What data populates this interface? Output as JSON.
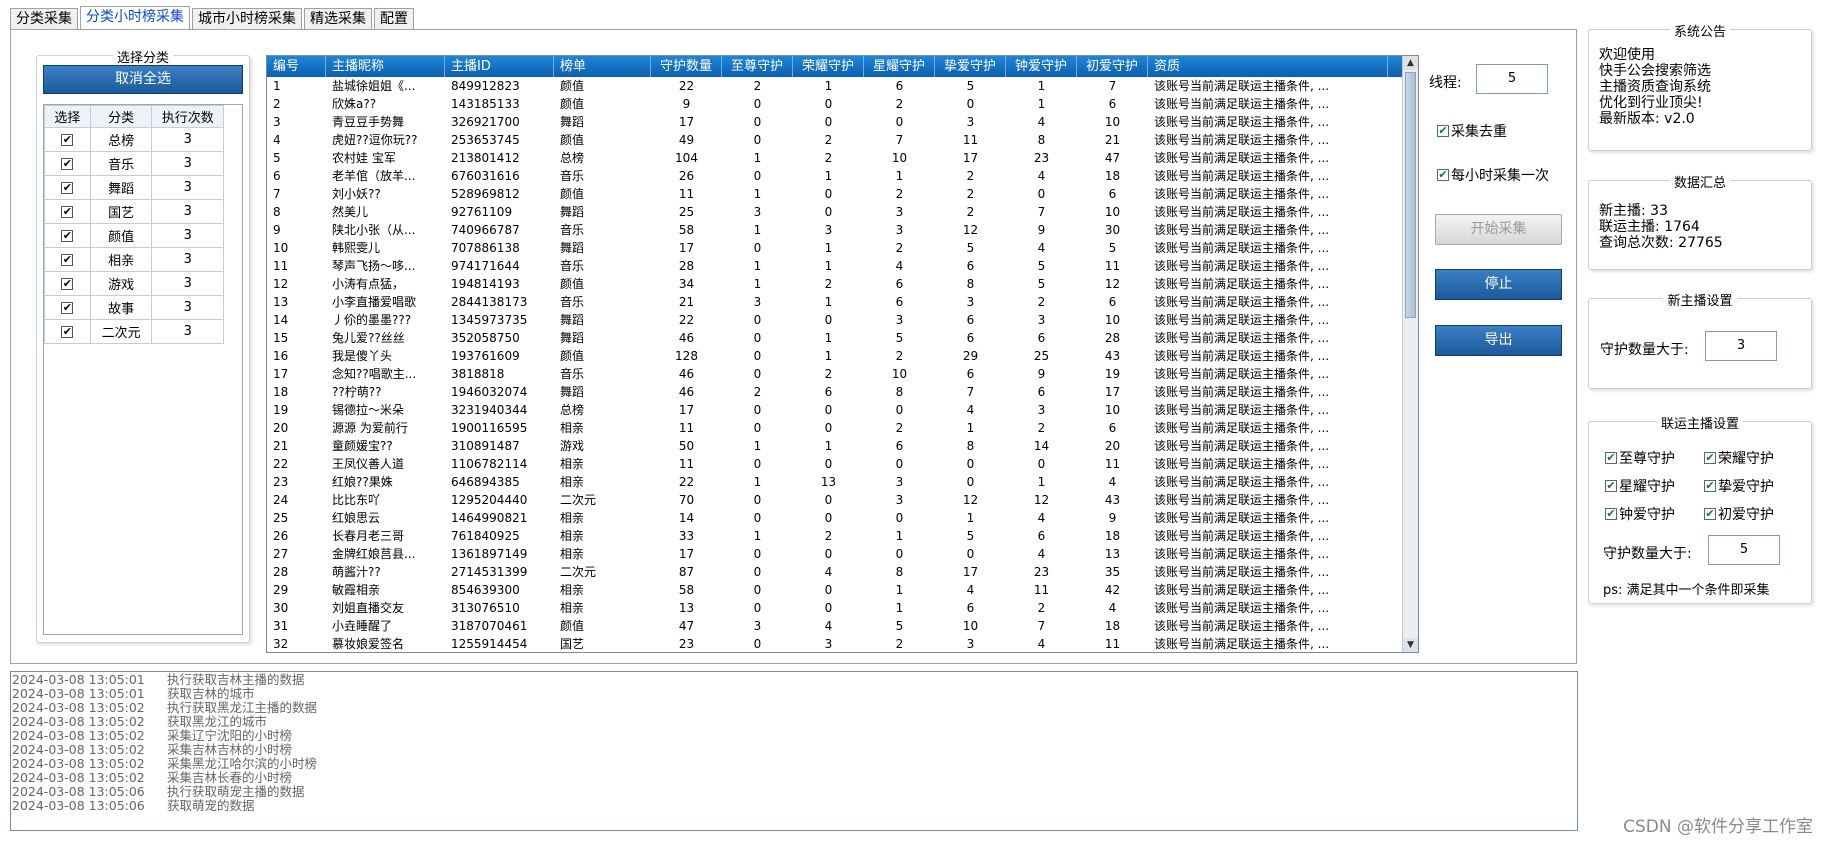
{
  "tabs": [
    "分类采集",
    "分类小时榜采集",
    "城市小时榜采集",
    "精选采集",
    "配置"
  ],
  "category_group": {
    "title": "选择分类",
    "deselect_button": "取消全选",
    "headers": [
      "选择",
      "分类",
      "执行次数"
    ],
    "rows": [
      {
        "name": "总榜",
        "count": "3"
      },
      {
        "name": "音乐",
        "count": "3"
      },
      {
        "name": "舞蹈",
        "count": "3"
      },
      {
        "name": "国艺",
        "count": "3"
      },
      {
        "name": "颜值",
        "count": "3"
      },
      {
        "name": "相亲",
        "count": "3"
      },
      {
        "name": "游戏",
        "count": "3"
      },
      {
        "name": "故事",
        "count": "3"
      },
      {
        "name": "二次元",
        "count": "3"
      }
    ]
  },
  "grid": {
    "headers": [
      "编号",
      "主播昵称",
      "主播ID",
      "榜单",
      "守护数量",
      "至尊守护",
      "荣耀守护",
      "星耀守护",
      "挚爱守护",
      "钟爱守护",
      "初爱守护",
      "资质"
    ],
    "qualification": "该账号当前满足联运主播条件, ...",
    "rows": [
      [
        "1",
        "盐城徐姐姐《...",
        "849912823",
        "颜值",
        "22",
        "2",
        "1",
        "6",
        "5",
        "1",
        "7"
      ],
      [
        "2",
        "欣姝a??",
        "143185133",
        "颜值",
        "9",
        "0",
        "0",
        "2",
        "0",
        "1",
        "6"
      ],
      [
        "3",
        "青豆豆手势舞",
        "326921700",
        "舞蹈",
        "17",
        "0",
        "0",
        "0",
        "3",
        "4",
        "10"
      ],
      [
        "4",
        "虎妞??逗你玩??",
        "253653745",
        "颜值",
        "49",
        "0",
        "2",
        "7",
        "11",
        "8",
        "21"
      ],
      [
        "5",
        "农村娃 宝军",
        "213801412",
        "总榜",
        "104",
        "1",
        "2",
        "10",
        "17",
        "23",
        "47"
      ],
      [
        "6",
        "老羊倌（放羊...",
        "676031616",
        "音乐",
        "26",
        "0",
        "1",
        "1",
        "2",
        "4",
        "18"
      ],
      [
        "7",
        "刘小妖??",
        "528969812",
        "颜值",
        "11",
        "1",
        "0",
        "2",
        "2",
        "0",
        "6"
      ],
      [
        "8",
        "然美儿",
        "92761109",
        "舞蹈",
        "25",
        "3",
        "0",
        "3",
        "2",
        "7",
        "10"
      ],
      [
        "9",
        "陕北小张（从...",
        "740966787",
        "音乐",
        "58",
        "1",
        "3",
        "3",
        "12",
        "9",
        "30"
      ],
      [
        "10",
        "韩熙雯儿",
        "707886138",
        "舞蹈",
        "17",
        "0",
        "1",
        "2",
        "5",
        "4",
        "5"
      ],
      [
        "11",
        "琴声飞扬～哆...",
        "974171644",
        "音乐",
        "28",
        "1",
        "1",
        "4",
        "6",
        "5",
        "11"
      ],
      [
        "12",
        "小涛有点猛，",
        "194814193",
        "颜值",
        "34",
        "1",
        "2",
        "6",
        "8",
        "5",
        "12"
      ],
      [
        "13",
        "小李直播爱唱歌",
        "2844138173",
        "音乐",
        "21",
        "3",
        "1",
        "6",
        "3",
        "2",
        "6"
      ],
      [
        "14",
        "丿伱的墨墨???",
        "1345973735",
        "舞蹈",
        "22",
        "0",
        "0",
        "3",
        "6",
        "3",
        "10"
      ],
      [
        "15",
        "兔儿爱??丝丝",
        "352058750",
        "舞蹈",
        "46",
        "0",
        "1",
        "5",
        "6",
        "6",
        "28"
      ],
      [
        "16",
        "我是傻丫头",
        "193761609",
        "颜值",
        "128",
        "0",
        "1",
        "2",
        "29",
        "25",
        "43"
      ],
      [
        "17",
        "念知??唱歌主...",
        "3818818",
        "音乐",
        "46",
        "0",
        "2",
        "10",
        "6",
        "9",
        "19"
      ],
      [
        "18",
        "??柠萌??",
        "1946032074",
        "舞蹈",
        "46",
        "2",
        "6",
        "8",
        "7",
        "6",
        "17"
      ],
      [
        "19",
        "锡德拉～米朵",
        "3231940344",
        "总榜",
        "17",
        "0",
        "0",
        "0",
        "4",
        "3",
        "10"
      ],
      [
        "20",
        "源源 为爱前行",
        "1900116595",
        "相亲",
        "11",
        "0",
        "0",
        "2",
        "1",
        "2",
        "6"
      ],
      [
        "21",
        "童颜媛宝??",
        "310891487",
        "游戏",
        "50",
        "1",
        "1",
        "6",
        "8",
        "14",
        "20"
      ],
      [
        "22",
        "王凤仪善人道",
        "1106782114",
        "相亲",
        "11",
        "0",
        "0",
        "0",
        "0",
        "0",
        "11"
      ],
      [
        "23",
        "红娘??果姝",
        "646894385",
        "相亲",
        "22",
        "1",
        "13",
        "3",
        "0",
        "1",
        "4"
      ],
      [
        "24",
        "比比东吖",
        "1295204440",
        "二次元",
        "70",
        "0",
        "0",
        "3",
        "12",
        "12",
        "43"
      ],
      [
        "25",
        "红娘思云",
        "1464990821",
        "相亲",
        "14",
        "0",
        "0",
        "0",
        "1",
        "4",
        "9"
      ],
      [
        "26",
        "长春月老三哥",
        "761840925",
        "相亲",
        "33",
        "1",
        "2",
        "1",
        "5",
        "6",
        "18"
      ],
      [
        "27",
        "金牌红娘莒县...",
        "1361897149",
        "相亲",
        "17",
        "0",
        "0",
        "0",
        "0",
        "4",
        "13"
      ],
      [
        "28",
        "萌酱汁??",
        "2714531399",
        "二次元",
        "87",
        "0",
        "4",
        "8",
        "17",
        "23",
        "35"
      ],
      [
        "29",
        "敏霞相亲",
        "854639300",
        "相亲",
        "58",
        "0",
        "0",
        "1",
        "4",
        "11",
        "42"
      ],
      [
        "30",
        "刘姐直播交友",
        "313076510",
        "相亲",
        "13",
        "0",
        "0",
        "1",
        "6",
        "2",
        "4"
      ],
      [
        "31",
        "小垚睡醒了",
        "3187070461",
        "颜值",
        "47",
        "3",
        "4",
        "5",
        "10",
        "7",
        "18"
      ],
      [
        "32",
        "慕妆娘爱签名",
        "1255914454",
        "国艺",
        "23",
        "0",
        "3",
        "2",
        "3",
        "4",
        "11"
      ]
    ]
  },
  "controls": {
    "threads_label": "线程:",
    "threads_value": "5",
    "dedupe_label": "采集去重",
    "hourly_label": "每小时采集一次",
    "start_button": "开始采集",
    "stop_button": "停止",
    "export_button": "导出"
  },
  "system_notice": {
    "title": "系统公告",
    "lines": [
      "欢迎使用",
      "快手公会搜索筛选",
      "主播资质查询系统",
      "优化到行业顶尖!",
      "最新版本: v2.0"
    ]
  },
  "stats": {
    "title": "数据汇总",
    "lines": [
      "新主播: 33",
      "联运主播: 1764",
      "查询总次数: 27765"
    ]
  },
  "new_anchor": {
    "title": "新主播设置",
    "label": "守护数量大于:",
    "value": "3"
  },
  "joint_anchor": {
    "title": "联运主播设置",
    "checks": [
      "至尊守护",
      "荣耀守护",
      "星耀守护",
      "挚爱守护",
      "钟爱守护",
      "初爱守护"
    ],
    "label": "守护数量大于:",
    "value": "5",
    "note": "ps: 满足其中一个条件即采集"
  },
  "log": [
    {
      "time": "2024-03-08 13:05:01",
      "msg": "执行获取吉林主播的数据"
    },
    {
      "time": "2024-03-08 13:05:01",
      "msg": "获取吉林的城市"
    },
    {
      "time": "2024-03-08 13:05:02",
      "msg": "执行获取黑龙江主播的数据"
    },
    {
      "time": "2024-03-08 13:05:02",
      "msg": "获取黑龙江的城市"
    },
    {
      "time": "2024-03-08 13:05:02",
      "msg": "采集辽宁沈阳的小时榜"
    },
    {
      "time": "2024-03-08 13:05:02",
      "msg": "采集吉林吉林的小时榜"
    },
    {
      "time": "2024-03-08 13:05:02",
      "msg": "采集黑龙江哈尔滨的小时榜"
    },
    {
      "time": "2024-03-08 13:05:02",
      "msg": "采集吉林长春的小时榜"
    },
    {
      "time": "2024-03-08 13:05:06",
      "msg": "执行获取萌宠主播的数据"
    },
    {
      "time": "2024-03-08 13:05:06",
      "msg": "获取萌宠的数据"
    }
  ],
  "watermark": "CSDN @软件分享工作室"
}
